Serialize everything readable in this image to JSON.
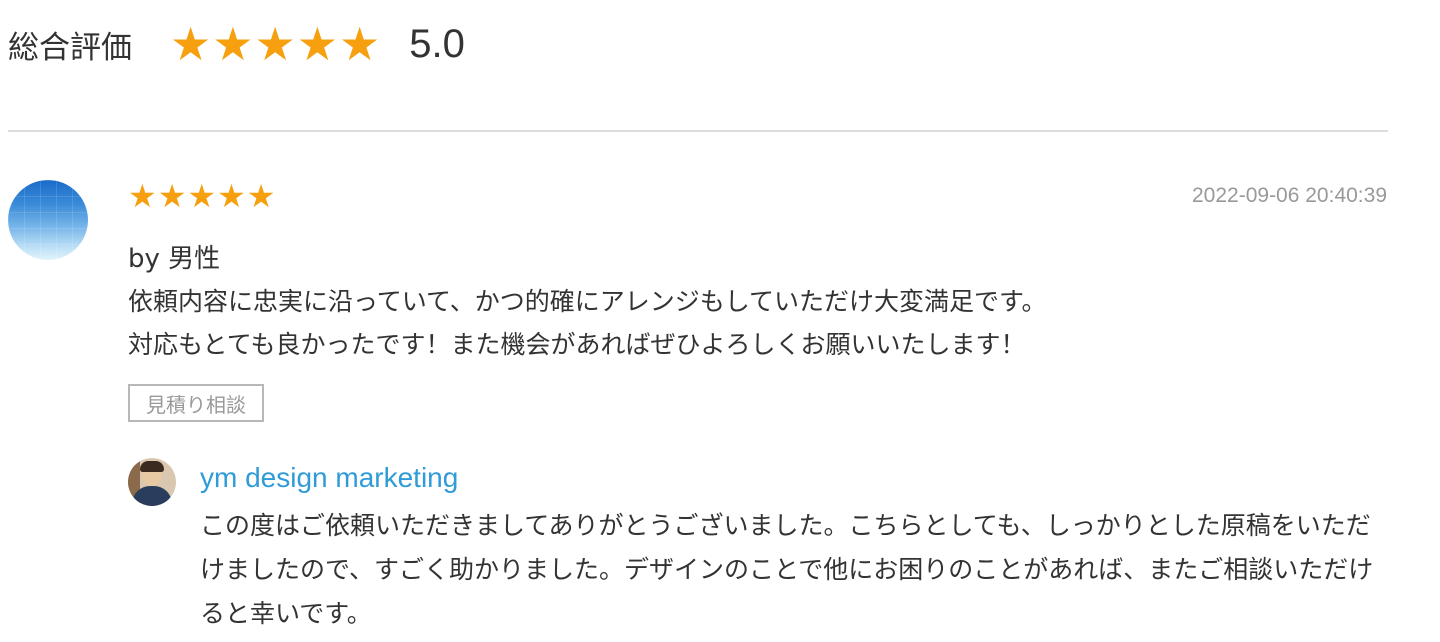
{
  "summary": {
    "label": "総合評価",
    "rating": 5,
    "score": "5.0",
    "star_color": "#f6a010"
  },
  "review": {
    "rating": 5,
    "timestamp": "2022-09-06 20:40:39",
    "reviewer": "by 男性",
    "comment_lines": [
      "依頼内容に忠実に沿っていて、かつ的確にアレンジもしていただけ大変満足です。",
      "対応もとても良かったです！また機会があればぜひよろしくお願いいたします！"
    ],
    "tag": "見積り相談",
    "avatar_icon": "blue-gradient-avatar-icon"
  },
  "reply": {
    "name": "ym design marketing",
    "name_color": "#2f9bd7",
    "body": "この度はご依頼いただきましてありがとうございました。こちらとしても、しっかりとした原稿をいただけましたので、すごく助かりました。デザインのことで他にお困りのことがあれば、またご相談いただけると幸いです。",
    "avatar_icon": "seller-photo-avatar-icon"
  }
}
